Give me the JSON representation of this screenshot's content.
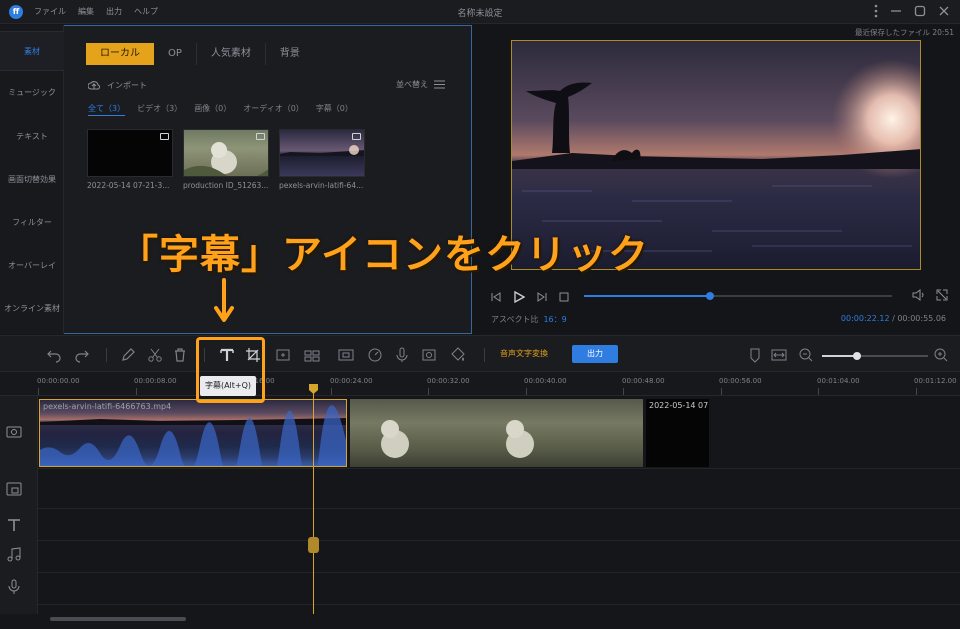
{
  "titlebar": {
    "app_logo": "ff",
    "menu": [
      "ファイル",
      "編集",
      "出力",
      "ヘルプ"
    ],
    "title": "名称未設定"
  },
  "sidebar": {
    "items": [
      {
        "label": "素材",
        "active": true
      },
      {
        "label": "ミュージック"
      },
      {
        "label": "テキスト"
      },
      {
        "label": "画面切替効果"
      },
      {
        "label": "フィルター"
      },
      {
        "label": "オーバーレイ"
      },
      {
        "label": "オンライン素材"
      }
    ]
  },
  "media": {
    "tabs": [
      {
        "label": "ローカル",
        "active": true
      },
      {
        "label": "OP"
      },
      {
        "label": "人気素材"
      },
      {
        "label": "背景"
      }
    ],
    "import_label": "インポート",
    "sort_label": "並べ替え",
    "filters": [
      {
        "label": "全て（3）",
        "active": true
      },
      {
        "label": "ビデオ（3）"
      },
      {
        "label": "画像（0）"
      },
      {
        "label": "オーディオ（0）"
      },
      {
        "label": "字幕（0）"
      }
    ],
    "items": [
      {
        "caption": "2022-05-14 07-21-3..."
      },
      {
        "caption": "production ID_51263..."
      },
      {
        "caption": "pexels-arvin-latifi-64..."
      }
    ]
  },
  "preview": {
    "saved_label": "最近保存したファイル 20:51",
    "progress": 0.41,
    "aspect_label": "アスペクト比",
    "aspect_value": "16：9",
    "current_time": "00:00:22.12",
    "time_separator": " / ",
    "total_time": "00:00:55.06"
  },
  "toolbar": {
    "stt_label": "音声文字変換",
    "export_label": "出力",
    "zoom_level": 0.33,
    "tooltip": "字幕(Alt+Q)"
  },
  "timeline": {
    "ruler_labels": [
      "00:00:00.00",
      "00:00:08.00",
      "00:00:16.00",
      "00:00:24.00",
      "00:00:32.00",
      "00:00:40.00",
      "00:00:48.00",
      "00:00:56.00",
      "00:01:04.00",
      "00:01:12.00"
    ],
    "clips": [
      {
        "name": "pexels-arvin-latifi-6466763.mp4"
      },
      {
        "name": ""
      },
      {
        "name": "2022-05-14 07"
      }
    ]
  },
  "annotation": {
    "text": "「字幕」アイコンをクリック"
  },
  "colors": {
    "accent": "#2f7de1",
    "highlight": "#ffa11a",
    "tab_active": "#e5a21b"
  }
}
